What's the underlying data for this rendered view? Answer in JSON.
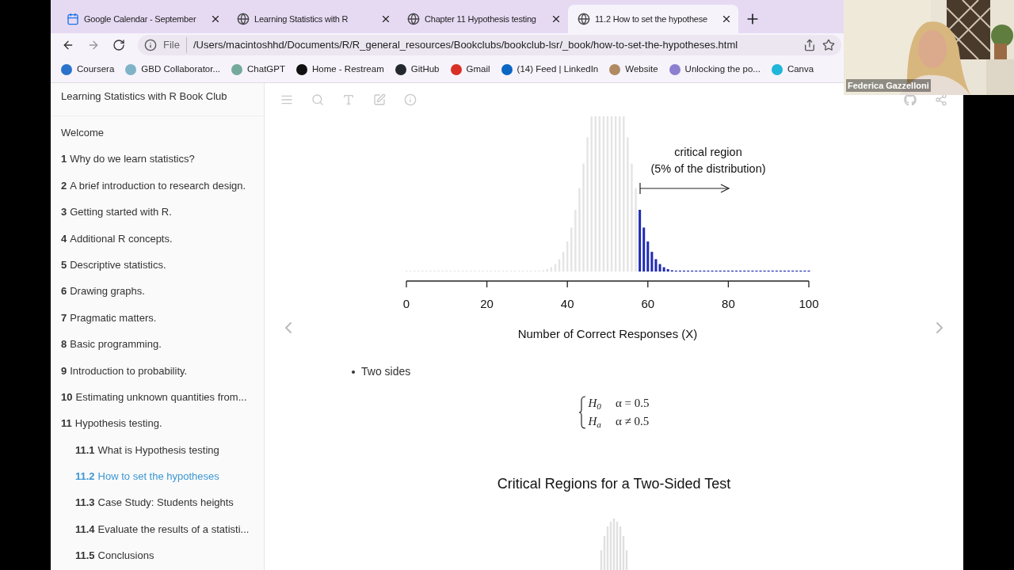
{
  "browser": {
    "tabs": [
      {
        "title": "Google Calendar - September",
        "kind": "calendar",
        "selected": false
      },
      {
        "title": "Learning Statistics with R",
        "kind": "globe",
        "selected": false
      },
      {
        "title": "Chapter 11 Hypothesis testing",
        "kind": "globe",
        "selected": false
      },
      {
        "title": "11.2 How to set the hypothese",
        "kind": "globe",
        "selected": true
      }
    ],
    "address": {
      "scheme": "File",
      "path": "/Users/macintoshhd/Documents/R/R_general_resources/Bookclubs/bookclub-lsr/_book/how-to-set-the-hypotheses.html"
    },
    "bookmarks": [
      {
        "label": "Coursera",
        "color": "#2a73cc"
      },
      {
        "label": "GBD Collaborator...",
        "color": "#7fb3c8"
      },
      {
        "label": "ChatGPT",
        "color": "#74aa9c"
      },
      {
        "label": "Home - Restream",
        "color": "#111111"
      },
      {
        "label": "GitHub",
        "color": "#24292f"
      },
      {
        "label": "Gmail",
        "color": "#d93025"
      },
      {
        "label": "(14) Feed | LinkedIn",
        "color": "#0a66c2"
      },
      {
        "label": "Website",
        "color": "#b08a60"
      },
      {
        "label": "Unlocking the po...",
        "color": "#8c7fd0"
      },
      {
        "label": "Canva",
        "color": "#1fb6d9"
      }
    ]
  },
  "book": {
    "title": "Learning Statistics with R Book Club",
    "toc": [
      {
        "label": "Welcome",
        "selected": false
      },
      {
        "number": "1",
        "label": "Why do we learn statistics?",
        "selected": false
      },
      {
        "number": "2",
        "label": "A brief introduction to research design.",
        "selected": false
      },
      {
        "number": "3",
        "label": "Getting started with R.",
        "selected": false
      },
      {
        "number": "4",
        "label": "Additional R concepts.",
        "selected": false
      },
      {
        "number": "5",
        "label": "Descriptive statistics.",
        "selected": false
      },
      {
        "number": "6",
        "label": "Drawing graphs.",
        "selected": false
      },
      {
        "number": "7",
        "label": "Pragmatic matters.",
        "selected": false
      },
      {
        "number": "8",
        "label": "Basic programming.",
        "selected": false
      },
      {
        "number": "9",
        "label": "Introduction to probability.",
        "selected": false
      },
      {
        "number": "10",
        "label": "Estimating unknown quantities from...",
        "selected": false
      },
      {
        "number": "11",
        "label": "Hypothesis testing.",
        "selected": false,
        "children": [
          {
            "number": "11.1",
            "label": "What is Hypothesis testing",
            "selected": false
          },
          {
            "number": "11.2",
            "label": "How to set the hypotheses",
            "selected": true
          },
          {
            "number": "11.3",
            "label": "Case Study: Students heights",
            "selected": false
          },
          {
            "number": "11.4",
            "label": "Evaluate the results of a statisti...",
            "selected": false
          },
          {
            "number": "11.5",
            "label": "Conclusions",
            "selected": false
          }
        ]
      }
    ]
  },
  "figure": {
    "annotation": [
      "critical region",
      "(5% of the distribution)"
    ],
    "x_ticks": [
      "0",
      "20",
      "40",
      "60",
      "80",
      "100"
    ],
    "xlabel": "Number of Correct Responses (X)"
  },
  "bullet": "Two sides",
  "hypotheses": [
    {
      "symbol": "H$_{0}$",
      "relation": "α = 0.5"
    },
    {
      "symbol": "H$_{a}$",
      "relation": "α ≠ 0.5"
    }
  ],
  "next_figure": {
    "title": "Critical Regions for a Two-Sided Test"
  },
  "video": {
    "name": "Federica Gazzelloni"
  }
}
